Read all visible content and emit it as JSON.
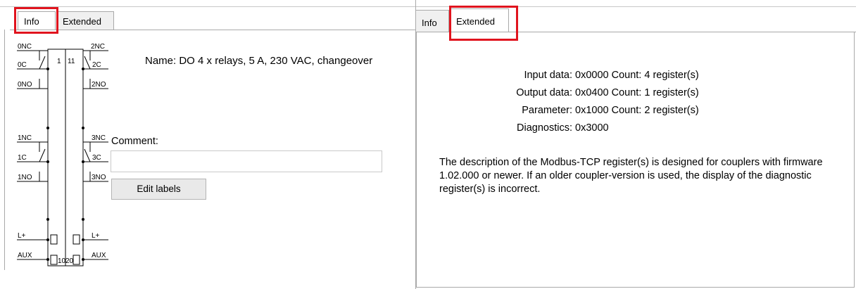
{
  "left": {
    "tabs": [
      {
        "label": "Info",
        "active": true
      },
      {
        "label": "Extended",
        "active": false
      }
    ],
    "name_line": "Name: DO 4 x relays, 5 A, 230 VAC, changeover",
    "comment_label": "Comment:",
    "comment_value": "",
    "edit_labels_button": "Edit labels",
    "diagram": {
      "left_labels": [
        "0NC",
        "0C",
        "0NO",
        "1NC",
        "1C",
        "1NO",
        "L+",
        "AUX"
      ],
      "right_labels": [
        "2NC",
        "2C",
        "2NO",
        "3NC",
        "3C",
        "3NO",
        "L+",
        "AUX"
      ],
      "top_numbers": [
        "1",
        "11"
      ],
      "bottom_numbers": [
        "10",
        "20"
      ]
    }
  },
  "right": {
    "tabs": [
      {
        "label": "Info",
        "active": false
      },
      {
        "label": "Extended",
        "active": true
      }
    ],
    "rows": [
      {
        "key": "Input data:",
        "value": "0x0000 Count: 4 register(s)"
      },
      {
        "key": "Output data:",
        "value": "0x0400 Count: 1 register(s)"
      },
      {
        "key": "Parameter:",
        "value": "0x1000 Count: 2 register(s)"
      },
      {
        "key": "Diagnostics:",
        "value": "0x3000"
      }
    ],
    "description": "The description of the Modbus-TCP register(s) is designed for couplers with firmware 1.02.000 or newer. If an older coupler-version is used, the display of the diagnostic register(s) is incorrect."
  },
  "colors": {
    "highlight": "#e0141e",
    "border": "#a9a9a9",
    "tab_bg": "#f0f0f0"
  }
}
